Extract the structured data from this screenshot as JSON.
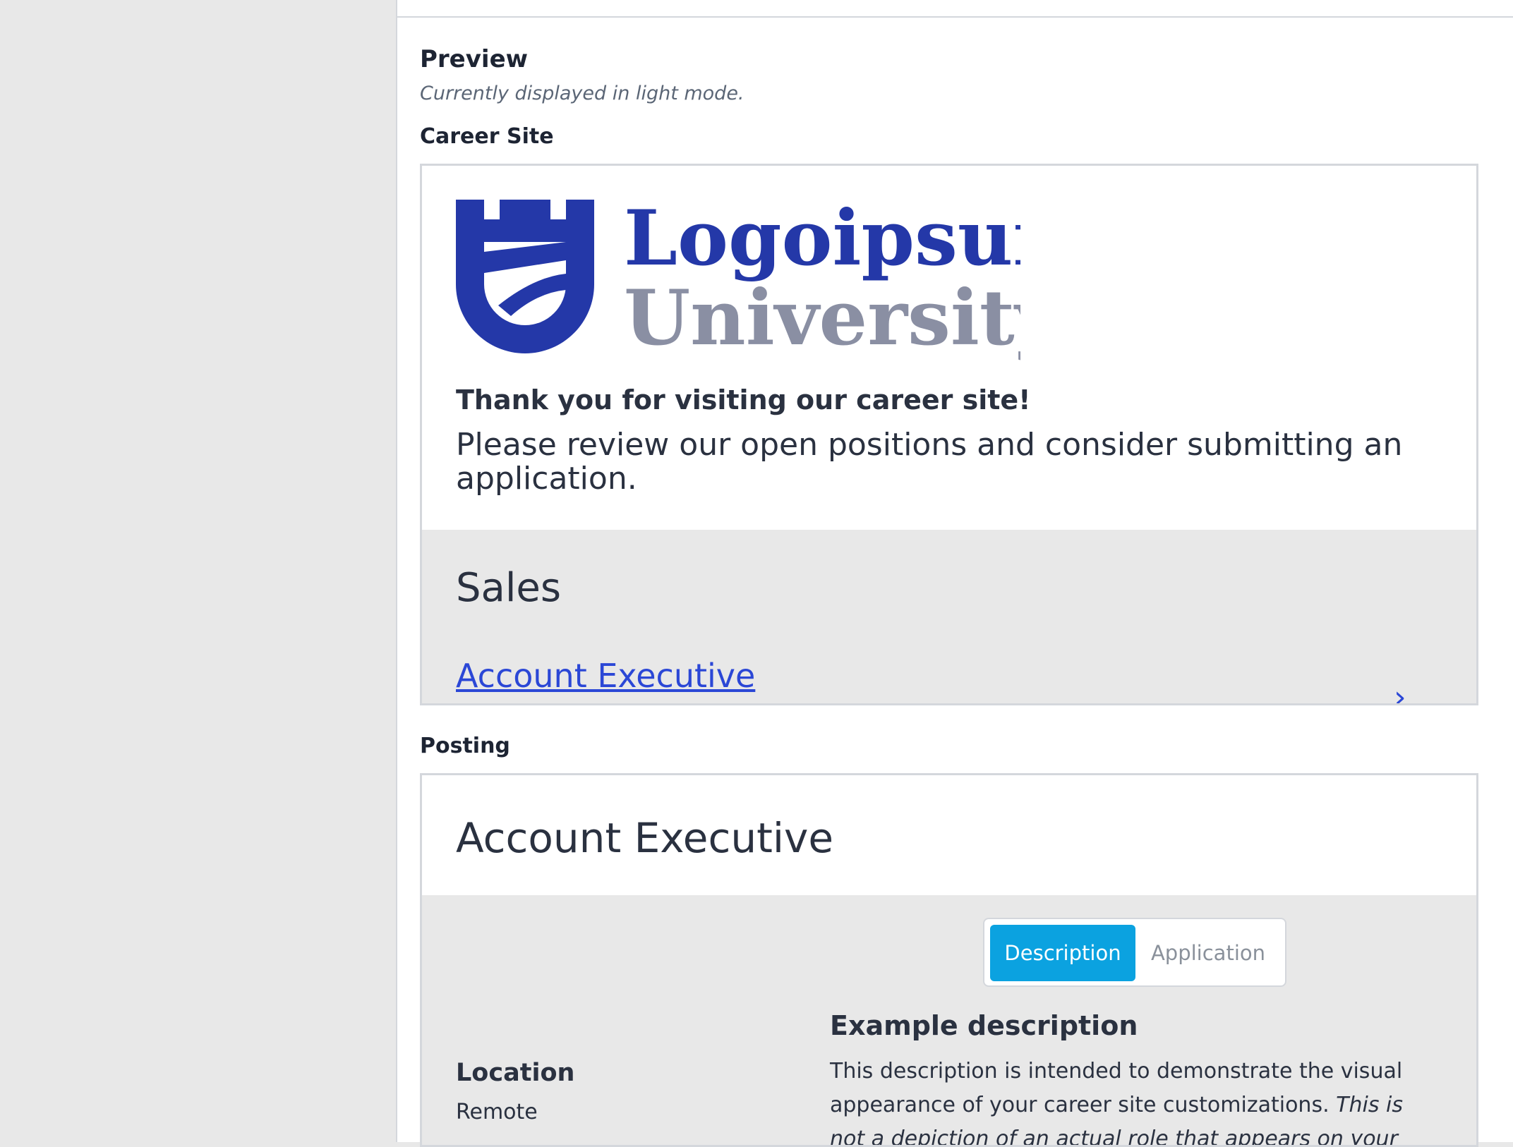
{
  "preview": {
    "title": "Preview",
    "subtitle": "Currently displayed in light mode."
  },
  "career_site": {
    "label": "Career Site",
    "logo": {
      "line1": "Logoipsum",
      "line2": "University",
      "color_primary": "#2438a8",
      "color_secondary": "#8a8fa3"
    },
    "thanks": "Thank you for visiting our career site!",
    "intro": "Please review our open positions and consider submitting an application.",
    "department": "Sales",
    "job_link": "Account Executive",
    "chevron": "›"
  },
  "posting": {
    "label": "Posting",
    "title": "Account Executive",
    "tabs": {
      "description": "Description",
      "application": "Application"
    },
    "active_tab": "Description",
    "description_heading": "Example description",
    "description_text_normal": "This description is intended to demonstrate the visual appearance of your career site customizations. ",
    "description_text_italic": "This is not a depiction of an actual role that appears on your career site.",
    "location_label": "Location",
    "location_value": "Remote"
  },
  "colors": {
    "accent_tab": "#0ba2e0",
    "link": "#2b47d6",
    "text": "#2a3140",
    "gray_bg": "#e8e8e8"
  }
}
